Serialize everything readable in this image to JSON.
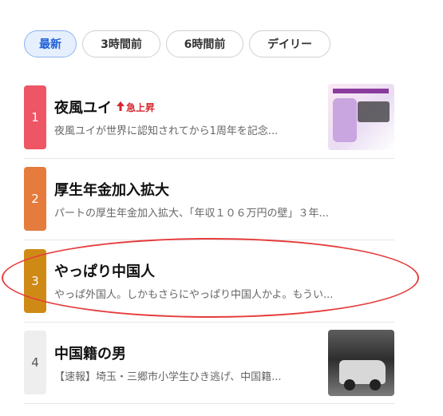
{
  "tabs": [
    {
      "label": "最新",
      "active": true
    },
    {
      "label": "3時間前",
      "active": false
    },
    {
      "label": "6時間前",
      "active": false
    },
    {
      "label": "デイリー",
      "active": false
    }
  ],
  "items": [
    {
      "rank": "1",
      "title": "夜風ユイ",
      "badge": "急上昇",
      "desc": "夜風ユイが世界に認知されてから1周年を記念...",
      "color": "#ee5565",
      "thumb": "vtuber-poster"
    },
    {
      "rank": "2",
      "title": "厚生年金加入拡大",
      "desc": "パートの厚生年金加入拡大、「年収１０６万円の壁」３年...",
      "color": "#e57b3c"
    },
    {
      "rank": "3",
      "title": "やっぱり中国人",
      "desc": "やっぱ外国人。しかもさらにやっぱり中国人かよ。もうい...",
      "color": "#cf8a16"
    },
    {
      "rank": "4",
      "title": "中国籍の男",
      "desc": "【速報】埼玉・三郷市小学生ひき逃げ、中国籍...",
      "color": "#eeeeee",
      "thumb": "news-photo-car"
    }
  ],
  "colors": {
    "accent": "#1f5fd6",
    "alert": "#d6262e",
    "annotation": "#e63c3c"
  }
}
